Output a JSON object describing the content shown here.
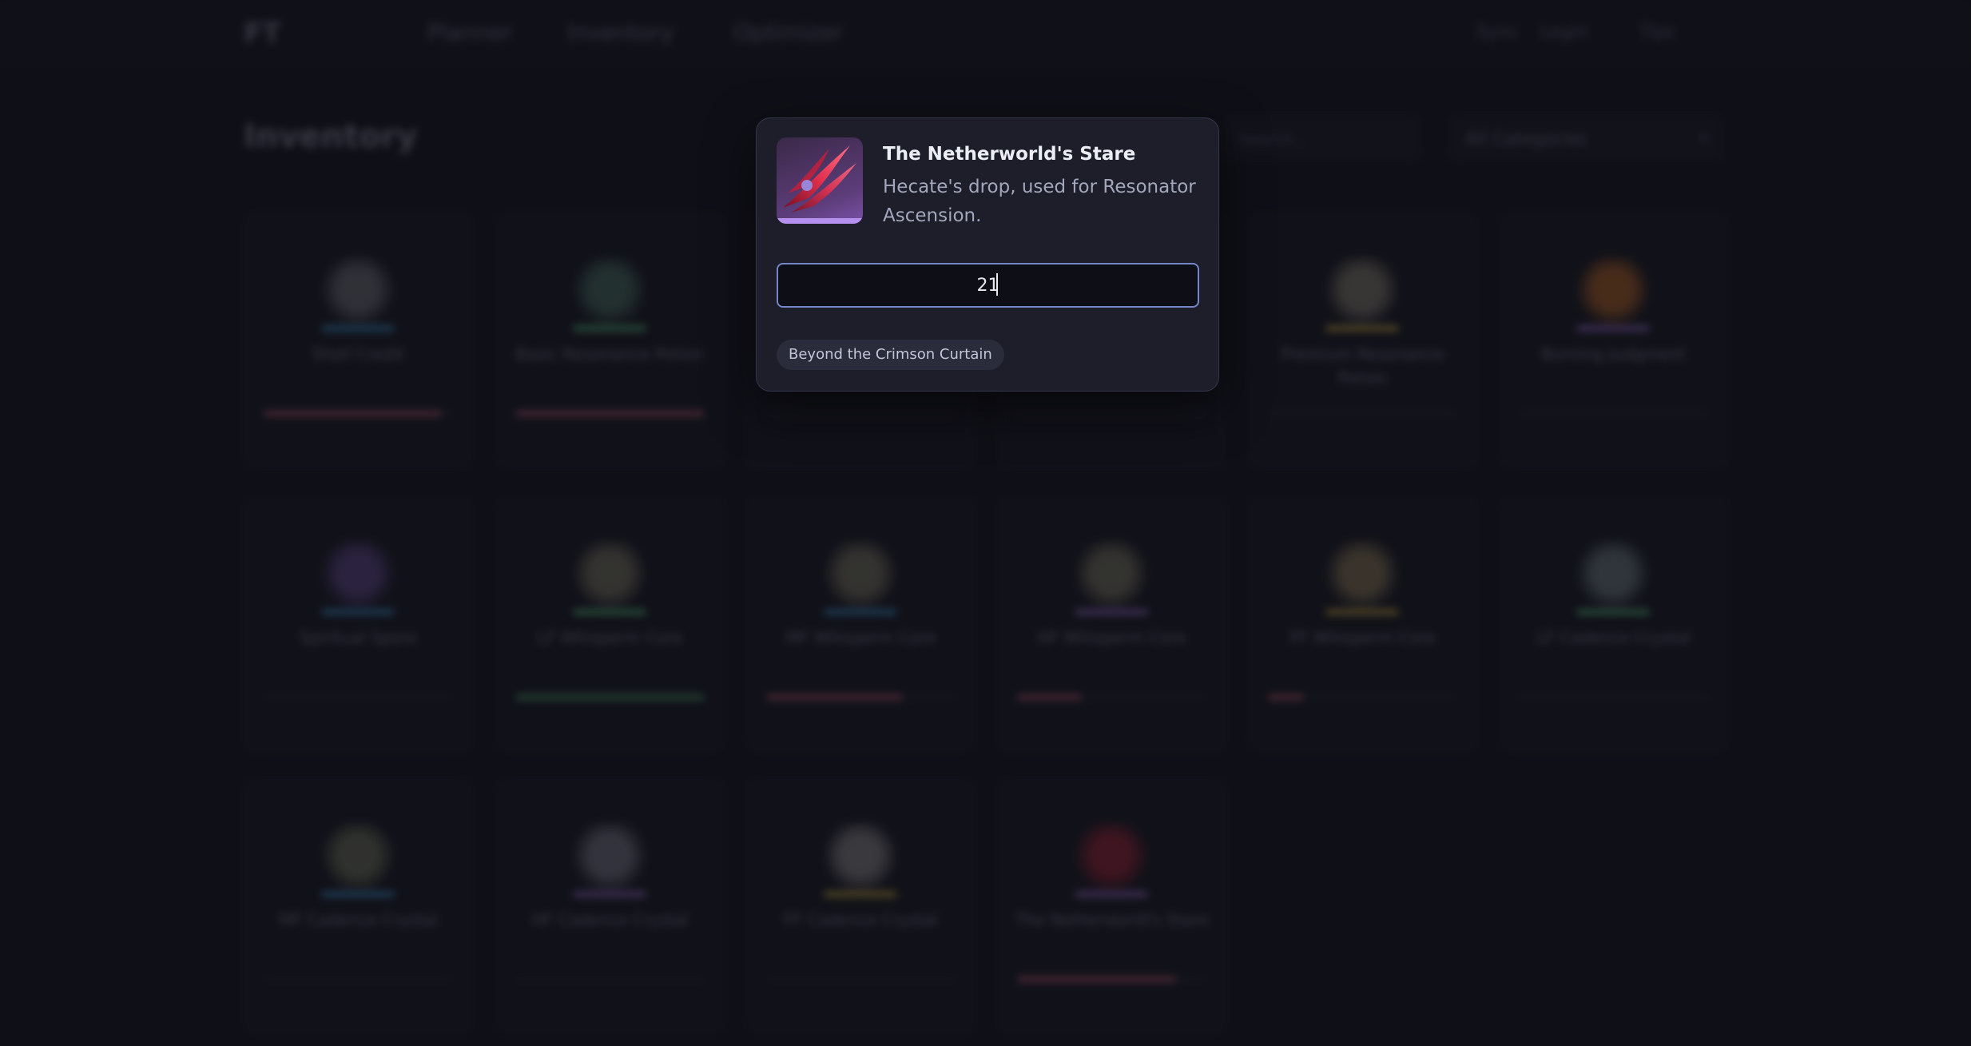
{
  "header": {
    "logo": "FT",
    "nav": [
      "Planner",
      "Inventory",
      "Optimizer"
    ],
    "right": [
      "Sync",
      "Login",
      "Tips"
    ]
  },
  "page": {
    "title": "Inventory",
    "search_placeholder": "Search...",
    "filter": "All Categories"
  },
  "inventory": [
    {
      "badge": "",
      "name": "Shell Credit",
      "count": "",
      "progress": 0.94,
      "bar_color": "#e56f88",
      "icon_color": "#8a8a94",
      "rarity_color": "#4aa8e8"
    },
    {
      "badge": "",
      "name": "Basic Resonance Potion",
      "count": "",
      "progress": 1.0,
      "bar_color": "#e56f88",
      "icon_color": "#5a8a74",
      "rarity_color": "#69d78a"
    },
    {
      "badge": "",
      "name": "",
      "count": "",
      "progress": 0,
      "bar_color": "#e56f88",
      "icon_color": "#1a1b25",
      "rarity_color": "#1a1b25"
    },
    {
      "badge": "",
      "name": "",
      "count": "",
      "progress": 0,
      "bar_color": "#e56f88",
      "icon_color": "#1a1b25",
      "rarity_color": "#1a1b25"
    },
    {
      "badge": "",
      "name": "Premium Resonance Potion",
      "count": "",
      "progress": 0,
      "bar_color": "#e56f88",
      "icon_color": "#a8a08a",
      "rarity_color": "#f2c84a"
    },
    {
      "badge": "",
      "name": "Burning Judgment",
      "count": "",
      "progress": 0,
      "bar_color": "#e56f88",
      "icon_color": "#e07a2a",
      "rarity_color": "#b07ee8"
    },
    {
      "badge": "",
      "name": "Spiritual Spore",
      "count": "",
      "progress": 0,
      "bar_color": "#e56f88",
      "icon_color": "#7a5ab0",
      "rarity_color": "#4aa8e8"
    },
    {
      "badge": "",
      "name": "LF Whisperin Core",
      "count": "",
      "progress": 1.0,
      "bar_color": "#5fc47a",
      "icon_color": "#9a9478",
      "rarity_color": "#69d78a"
    },
    {
      "badge": "",
      "name": "MF Whisperin Core",
      "count": "",
      "progress": 0.72,
      "bar_color": "#e56f88",
      "icon_color": "#9a9478",
      "rarity_color": "#4aa8e8"
    },
    {
      "badge": "",
      "name": "HF Whisperin Core",
      "count": "",
      "progress": 0.34,
      "bar_color": "#e56f88",
      "icon_color": "#9a9478",
      "rarity_color": "#b07ee8"
    },
    {
      "badge": "",
      "name": "FF Whisperin Core",
      "count": "",
      "progress": 0.19,
      "bar_color": "#e56f88",
      "icon_color": "#b0986a",
      "rarity_color": "#f2c84a"
    },
    {
      "badge": "",
      "name": "LF Cadence Crystal",
      "count": "",
      "progress": 0,
      "bar_color": "#e56f88",
      "icon_color": "#8a9aa0",
      "rarity_color": "#69d78a"
    },
    {
      "badge": "",
      "name": "MF Cadence Crystal",
      "count": "",
      "progress": 0,
      "bar_color": "#e56f88",
      "icon_color": "#8a9070",
      "rarity_color": "#4aa8e8"
    },
    {
      "badge": "",
      "name": "HF Cadence Crystal",
      "count": "",
      "progress": 0,
      "bar_color": "#e56f88",
      "icon_color": "#9a98a8",
      "rarity_color": "#b07ee8"
    },
    {
      "badge": "",
      "name": "FF Cadence Crystal",
      "count": "",
      "progress": 0,
      "bar_color": "#e56f88",
      "icon_color": "#b0aca8",
      "rarity_color": "#f2c84a"
    },
    {
      "badge": "",
      "name": "The Netherworld's Stare",
      "count": "",
      "progress": 0.84,
      "bar_color": "#e56f88",
      "icon_color": "#c0283e",
      "rarity_color": "#b07ee8"
    }
  ],
  "modal": {
    "title": "The Netherworld's Stare",
    "description": "Hecate's drop, used for Resonator Ascension.",
    "quantity": "21",
    "source_tag": "Beyond the Crimson Curtain",
    "icon_name": "crimson-claw-icon",
    "rarity_color": "#b690ef"
  }
}
